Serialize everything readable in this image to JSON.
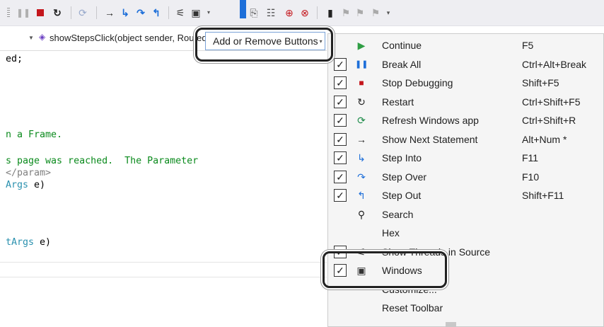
{
  "toolbar": {
    "icons": [
      "pause-icon",
      "stop-icon",
      "restart-icon",
      "refresh-windows-app-icon",
      "show-next-statement-icon",
      "step-into-icon",
      "step-over-icon",
      "step-out-icon",
      "show-threads-in-source-icon",
      "windows-icon",
      "bookmark-icon",
      "file-icon",
      "file-list-icon",
      "insert-breakpoint-icon",
      "remove-breakpoint-icon",
      "toggle-bookmark-icon",
      "prev-bookmark-icon",
      "next-bookmark-icon",
      "clear-bookmarks-icon",
      "toolbar-options-icon"
    ]
  },
  "editor": {
    "nav_method": "showStepsClick(object sender, RoutedEventArgs e)",
    "lines": {
      "l1": "ed;",
      "l2": "n a Frame.",
      "l3": "s page was reached.  The Parameter",
      "l4_tag": "</param>",
      "l5_type": "Args",
      "l5_rest": " e)",
      "l6_type": "tArgs",
      "l6_rest": " e)"
    }
  },
  "dropdown": {
    "label": "Add or Remove Buttons"
  },
  "menu": {
    "items": [
      {
        "label": "Continue",
        "shortcut": "F5",
        "checked": false,
        "icon": "continue-icon"
      },
      {
        "label": "Break All",
        "shortcut": "Ctrl+Alt+Break",
        "checked": true,
        "icon": "pause-icon"
      },
      {
        "label": "Stop Debugging",
        "shortcut": "Shift+F5",
        "checked": true,
        "icon": "stop-icon"
      },
      {
        "label": "Restart",
        "shortcut": "Ctrl+Shift+F5",
        "checked": true,
        "icon": "restart-icon"
      },
      {
        "label": "Refresh Windows app",
        "shortcut": "Ctrl+Shift+R",
        "checked": true,
        "icon": "refresh-icon"
      },
      {
        "label": "Show Next Statement",
        "shortcut": "Alt+Num *",
        "checked": true,
        "icon": "arrow-right-icon"
      },
      {
        "label": "Step Into",
        "shortcut": "F11",
        "checked": true,
        "icon": "step-into-icon"
      },
      {
        "label": "Step Over",
        "shortcut": "F10",
        "checked": true,
        "icon": "step-over-icon"
      },
      {
        "label": "Step Out",
        "shortcut": "Shift+F11",
        "checked": true,
        "icon": "step-out-icon"
      },
      {
        "label": "Search",
        "shortcut": "",
        "checked": false,
        "icon": "search-icon"
      },
      {
        "label": "Hex",
        "shortcut": "",
        "checked": false,
        "icon": ""
      },
      {
        "label": "Show Threads in Source",
        "shortcut": "",
        "checked": true,
        "icon": "threads-icon"
      },
      {
        "label": "Windows",
        "shortcut": "",
        "checked": true,
        "icon": "windows-icon"
      },
      {
        "label": "Customize...",
        "shortcut": "",
        "checked": false,
        "icon": ""
      },
      {
        "label": "Reset Toolbar",
        "shortcut": "",
        "checked": false,
        "icon": ""
      }
    ]
  },
  "colors": {
    "green": "#2f9e44",
    "stop_red": "#c4161c",
    "accent_blue": "#1e6fd9",
    "comment": "#0a8a1c",
    "type": "#2b91af"
  }
}
